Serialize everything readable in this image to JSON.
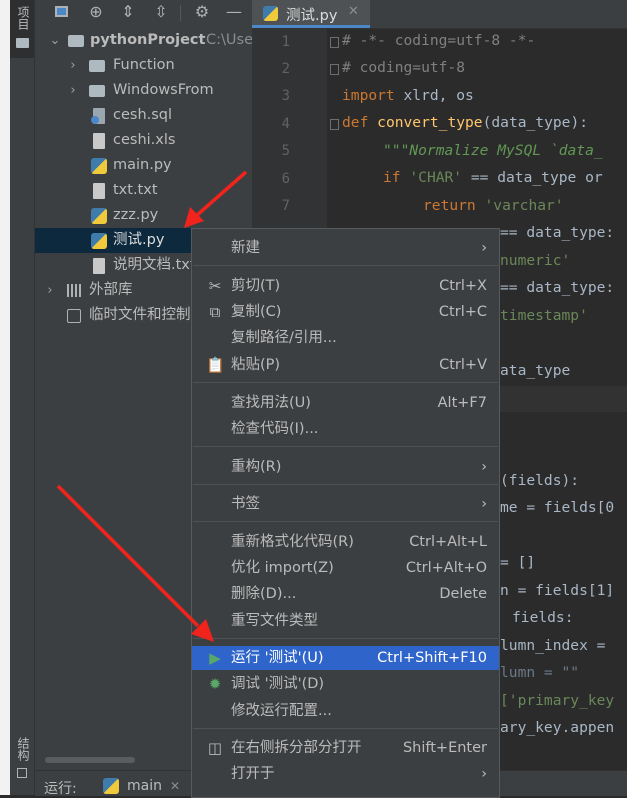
{
  "sidebar": {
    "project_tab": "项目",
    "structure_tab": "结构"
  },
  "project": {
    "root_name": "pythonProject",
    "root_path": "C:\\Use",
    "items": [
      {
        "label": "Function",
        "type": "folder"
      },
      {
        "label": "WindowsFrom",
        "type": "folder"
      },
      {
        "label": "cesh.sql",
        "type": "sql"
      },
      {
        "label": "ceshi.xls",
        "type": "xls"
      },
      {
        "label": "main.py",
        "type": "py"
      },
      {
        "label": "txt.txt",
        "type": "txt"
      },
      {
        "label": "zzz.py",
        "type": "py"
      },
      {
        "label": "测试.py",
        "type": "py",
        "selected": true
      },
      {
        "label": "说明文档.txt",
        "type": "txt"
      }
    ],
    "external_libs": "外部库",
    "scratches": "临时文件和控制"
  },
  "editor": {
    "tab_label": "测试.py",
    "line_numbers": [
      "1",
      "2",
      "3",
      "4",
      "5",
      "6",
      "7"
    ],
    "lines": {
      "l1": "# -*- coding=utf-8 -*-",
      "l2": "# coding=utf-8",
      "l3_kw": "import",
      "l3_rest": " xlrd, os",
      "l4_kw": "def",
      "l4_fn": "convert_type",
      "l4_rest": "(data_type):",
      "l5": "\"\"\"Normalize MySQL `data_",
      "l6_kw": "if",
      "l6_st": "'CHAR'",
      "l6_rest": " == data_type or",
      "l7_kw": "return",
      "l7_st": "'varchar'",
      "r8": "== data_type:",
      "r9": "numeric'",
      "r10": "== data_type:",
      "r11": "timestamp'",
      "r13": "ata_type",
      "r17": "(fields):",
      "r18": "me = fields[0",
      "r20": "= []",
      "r21": "n = fields[1]",
      "r22": "fields:",
      "r23": "lumn_index =",
      "r24": "lumn = \"\"",
      "r25": "['primary_key",
      "r26": "ary_key.appen"
    }
  },
  "context_menu": {
    "new": "新建",
    "cut": "剪切(T)",
    "cut_key": "Ctrl+X",
    "copy": "复制(C)",
    "copy_key": "Ctrl+C",
    "copy_path": "复制路径/引用...",
    "paste": "粘贴(P)",
    "paste_key": "Ctrl+V",
    "find_usages": "查找用法(U)",
    "find_usages_key": "Alt+F7",
    "inspect": "检查代码(I)...",
    "refactor": "重构(R)",
    "bookmarks": "书签",
    "reformat": "重新格式化代码(R)",
    "reformat_key": "Ctrl+Alt+L",
    "optimize": "优化 import(Z)",
    "optimize_key": "Ctrl+Alt+O",
    "delete": "删除(D)...",
    "delete_key": "Delete",
    "override_type": "重写文件类型",
    "run": "运行 '测试'(U)",
    "run_key": "Ctrl+Shift+F10",
    "debug": "调试 '测试'(D)",
    "modify_run": "修改运行配置...",
    "split_open": "在右侧拆分部分打开",
    "split_open_key": "Shift+Enter",
    "open_in": "打开于"
  },
  "bottom": {
    "run_label": "运行:",
    "run_tab": "main"
  },
  "colors": {
    "highlight": "#2f65ca",
    "arrow": "#f0231d",
    "run_green": "#59a869"
  }
}
